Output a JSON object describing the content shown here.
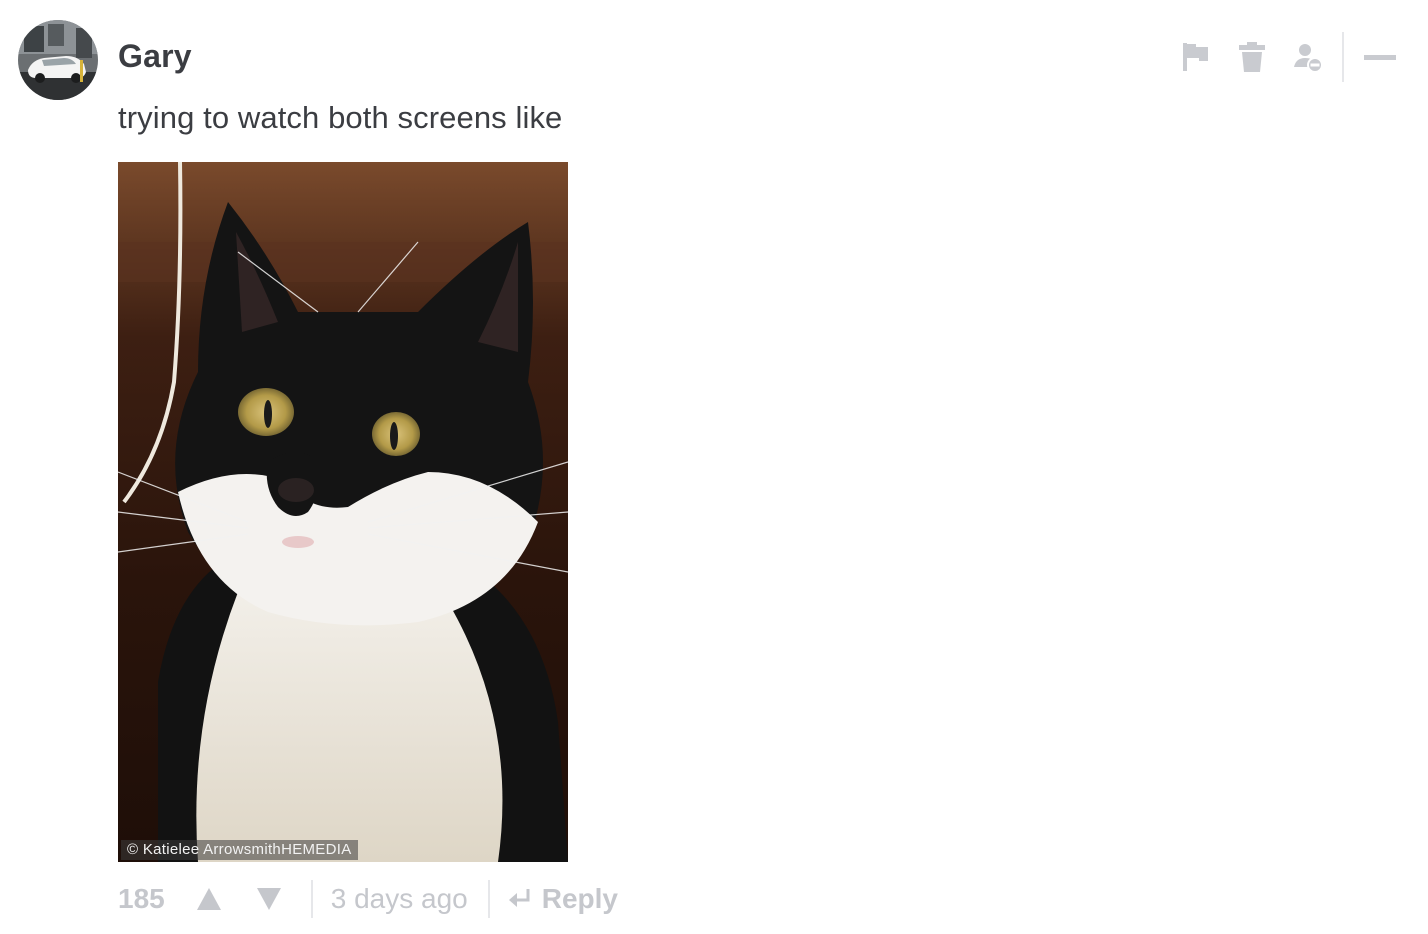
{
  "comment": {
    "author": "Gary",
    "text": "trying to watch both screens like",
    "avatar_icon": "car-avatar",
    "image": {
      "description_icon": "cat-photo",
      "watermark": "© Katielee ArrowsmithHEMEDIA"
    },
    "score": "185",
    "timestamp": "3 days ago",
    "reply_label": "Reply"
  },
  "actions": {
    "icons": [
      "flag-icon",
      "trash-icon",
      "block-user-icon",
      "collapse-icon"
    ]
  },
  "colors": {
    "text": "#3b3d42",
    "muted": "#c5c7cc",
    "icon": "#c9cbd0",
    "separator": "#e6e7ea"
  }
}
